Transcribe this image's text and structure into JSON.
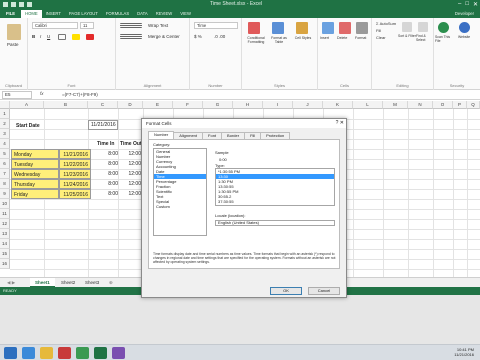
{
  "app": {
    "window_title": "Time Sheet.xlsx - Excel",
    "user": "Developer",
    "min_glyph": "–",
    "max_glyph": "□",
    "close_glyph": "✕"
  },
  "ribbon": {
    "tabs": [
      "FILE",
      "HOME",
      "INSERT",
      "PAGE LAYOUT",
      "FORMULAS",
      "DATA",
      "REVIEW",
      "VIEW",
      "Developer"
    ],
    "font_name": "Calibri",
    "font_size": "11",
    "wrap_text": "Wrap Text",
    "merge_center": "Merge & Center",
    "number_format": "Time",
    "autosum": "AutoSum",
    "fill": "Fill",
    "clear": "Clear",
    "groups": {
      "clipboard": "Clipboard",
      "font": "Font",
      "alignment": "Alignment",
      "number": "Number",
      "styles": "Styles",
      "cells": "Cells",
      "editing": "Editing",
      "security": "Security"
    },
    "buttons": {
      "paste": "Paste",
      "conditional_formatting": "Conditional Formatting",
      "format_as_table": "Format as Table",
      "cell_styles": "Cell Styles",
      "insert": "Insert",
      "delete": "Delete",
      "format": "Format",
      "sort_filter": "Sort & Filter",
      "find_select": "Find & Select",
      "scan_file": "Scan This File",
      "website": "Website"
    },
    "accent_color": "#1f7244"
  },
  "formula_bar": {
    "name_box": "E5",
    "fx_label": "fx",
    "formula": "=(F7-C7)+(F8-F9)"
  },
  "sheet": {
    "columns": [
      "A",
      "B",
      "C",
      "D",
      "E",
      "F",
      "G",
      "H",
      "I",
      "J",
      "K",
      "L",
      "M",
      "N",
      "O",
      "P",
      "Q"
    ],
    "rows": [
      "1",
      "2",
      "3",
      "4",
      "5",
      "6",
      "7",
      "8",
      "9",
      "10",
      "11",
      "12",
      "13",
      "14",
      "15",
      "16"
    ],
    "start_label": "Start Date",
    "start_value": "11/21/2016",
    "header_time_in": "Time In",
    "header_time_out": "Time Out",
    "days": [
      {
        "day": "Monday",
        "date": "11/21/2016",
        "time_in": "8:00",
        "time_out": "12:00"
      },
      {
        "day": "Tuesday",
        "date": "11/22/2016",
        "time_in": "8:00",
        "time_out": "12:00"
      },
      {
        "day": "Wednesday",
        "date": "11/23/2016",
        "time_in": "8:00",
        "time_out": "12:00"
      },
      {
        "day": "Thursday",
        "date": "11/24/2016",
        "time_in": "8:00",
        "time_out": "12:00"
      },
      {
        "day": "Friday",
        "date": "11/25/2016",
        "time_in": "8:00",
        "time_out": "12:00"
      }
    ],
    "highlight_color": "#ffef7a",
    "tabs": [
      "Sheet1",
      "Sheet2",
      "Sheet3"
    ],
    "status": "READY"
  },
  "dialog": {
    "title": "Format Cells",
    "close_glyph": "?   ✕",
    "tabs": [
      "Number",
      "Alignment",
      "Font",
      "Border",
      "Fill",
      "Protection"
    ],
    "category_label": "Category:",
    "categories": [
      "General",
      "Number",
      "Currency",
      "Accounting",
      "Date",
      "Time",
      "Percentage",
      "Fraction",
      "Scientific",
      "Text",
      "Special",
      "Custom"
    ],
    "selected_category": "Time",
    "sample_label": "Sample",
    "sample_value": "0:00",
    "type_label": "Type:",
    "types": [
      "*1:30:55 PM",
      "13:30",
      "1:30 PM",
      "13:30:55",
      "1:30:55 PM",
      "30:55.2",
      "37:30:55"
    ],
    "selected_type": "13:30",
    "locale_label": "Locale (location):",
    "locale_value": "English (United States)",
    "note": "Time formats display date and time serial numbers as time values. Time formats that begin with an asterisk (*) respond to changes in regional date and time settings that are specified for the operating system. Formats without an asterisk are not affected by operating system settings.",
    "ok": "OK",
    "cancel": "Cancel"
  },
  "taskbar": {
    "time": "10:41 PM",
    "date": "11/21/2016"
  }
}
